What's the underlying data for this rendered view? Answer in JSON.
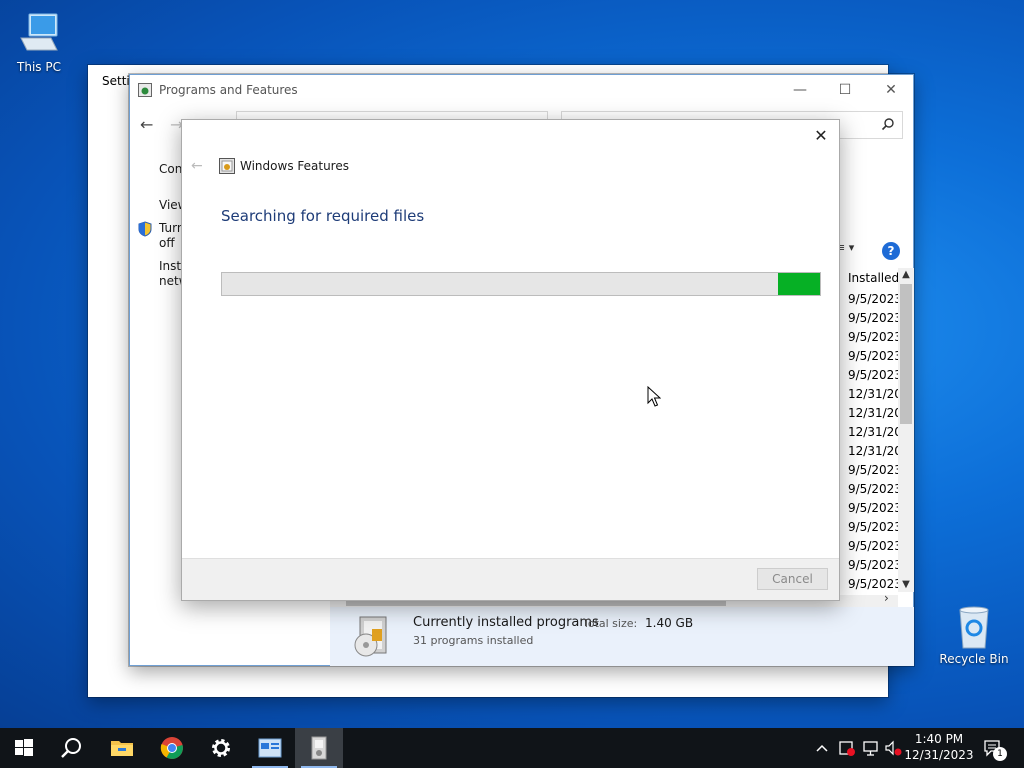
{
  "desktop": {
    "icons": [
      {
        "label": "This PC",
        "icon": "this-pc-icon"
      },
      {
        "label": "Recycle Bin",
        "icon": "recycle-bin-icon"
      }
    ]
  },
  "settings_window": {
    "title": "Settin"
  },
  "programs_window": {
    "title": "Programs and Features",
    "sidebar": {
      "item1": "Con",
      "item2": "View",
      "item3a": "Turn",
      "item3b": "off",
      "item4a": "Insta",
      "item4b": "netw"
    },
    "view_menu": "≡ ▾",
    "column_header": "Installed (",
    "dates": [
      "9/5/2023",
      "9/5/2023",
      "9/5/2023",
      "9/5/2023",
      "9/5/2023",
      "12/31/202",
      "12/31/202",
      "12/31/202",
      "12/31/202",
      "9/5/2023",
      "9/5/2023",
      "9/5/2023",
      "9/5/2023",
      "9/5/2023",
      "9/5/2023",
      "9/5/2023"
    ],
    "details": {
      "title": "Currently installed programs",
      "size_label": "Total size:",
      "size_value": "1.40 GB",
      "count": "31 programs installed"
    }
  },
  "windows_features": {
    "title": "Windows Features",
    "heading": "Searching for required files",
    "progress_fraction_start": 0.93,
    "progress_fraction_end": 1.0,
    "cancel_label": "Cancel"
  },
  "taskbar": {
    "apps": [
      "start-icon",
      "search-icon",
      "file-explorer-icon",
      "chrome-icon",
      "settings-gear-icon",
      "control-panel-icon",
      "programs-features-icon"
    ],
    "clock_time": "1:40 PM",
    "clock_date": "12/31/2023",
    "notification_count": "1"
  },
  "colors": {
    "progress_green": "#06b025",
    "heading_blue": "#1e3c78",
    "taskbar": "#101418"
  }
}
